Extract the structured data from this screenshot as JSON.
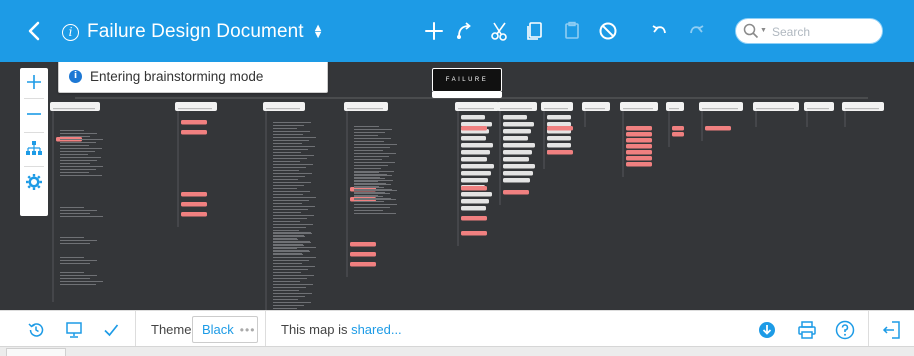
{
  "header": {
    "title": "Failure Design Document",
    "search_placeholder": "Search",
    "icons": [
      "back-icon",
      "info-icon",
      "sort-icon",
      "plus-icon",
      "connect-icon",
      "scissors-icon",
      "copy-icon",
      "paste-icon",
      "no-icon",
      "undo-icon",
      "redo-icon",
      "search-icon"
    ],
    "accent": "#1d9be6"
  },
  "notice": {
    "text": "Entering brainstorming mode"
  },
  "mindmap": {
    "root_label": "FAILURE",
    "background": "#343639",
    "highlight_color": "#f08080",
    "branch_count": 17
  },
  "footer": {
    "theme_label": "Theme",
    "theme_value": "Black",
    "theme_more": "•••",
    "shared_prefix": "This map is ",
    "shared_link": "shared..."
  }
}
